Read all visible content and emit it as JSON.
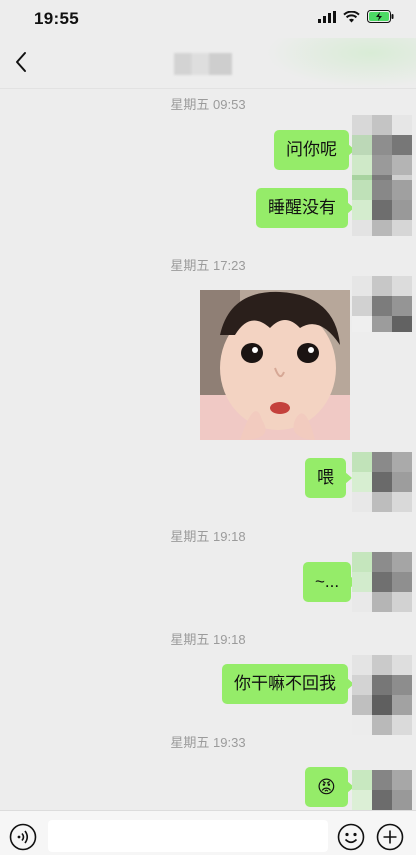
{
  "status": {
    "time": "19:55"
  },
  "messages": [
    {
      "type": "timestamp",
      "text": "星期五 09:53"
    },
    {
      "type": "text",
      "text": "问你呢"
    },
    {
      "type": "text",
      "text": "睡醒没有"
    },
    {
      "type": "timestamp",
      "text": "星期五 17:23"
    },
    {
      "type": "image",
      "description": "child-photo"
    },
    {
      "type": "text",
      "text": "喂"
    },
    {
      "type": "timestamp",
      "text": "星期五 19:18"
    },
    {
      "type": "text",
      "text": "~..."
    },
    {
      "type": "timestamp",
      "text": "星期五 19:18"
    },
    {
      "type": "text",
      "text": "你干嘛不回我"
    },
    {
      "type": "timestamp",
      "text": "星期五 19:33"
    },
    {
      "type": "emoji",
      "text": "😡"
    }
  ],
  "colors": {
    "bubble": "#95ec69",
    "background": "#ededed",
    "timestamp": "#9b9b9b"
  },
  "input_bar": {
    "left_icon": "voice-icon",
    "right_icons": [
      "emoji-icon",
      "plus-icon"
    ]
  }
}
